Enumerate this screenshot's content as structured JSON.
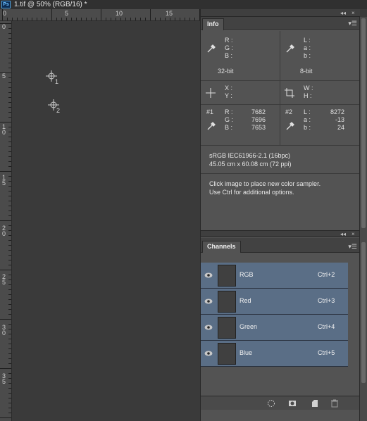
{
  "app_badge": "Ps",
  "document_title": "1.tif @ 50% (RGB/16) *",
  "rulers": {
    "top_numbers": [
      "0",
      "5",
      "10",
      "15"
    ],
    "left_numbers": [
      "0",
      "5",
      "10",
      "15",
      "20",
      "25",
      "30",
      "35"
    ]
  },
  "samplers": [
    {
      "label": "1"
    },
    {
      "label": "2"
    }
  ],
  "dock_controls": {
    "collapse": "◂◂",
    "close": "×"
  },
  "info_panel": {
    "tab_label": "Info",
    "menu_icon": "panel-menu-icon",
    "rgb_labels": {
      "r": "R :",
      "g": "G :",
      "b": "B :"
    },
    "lab_labels": {
      "l": "L :",
      "a": "a :",
      "b": "b :"
    },
    "left_bit_depth": "32-bit",
    "right_bit_depth": "8-bit",
    "xy_labels": {
      "x": "X :",
      "y": "Y :"
    },
    "wh_labels": {
      "w": "W :",
      "h": "H :"
    },
    "sampler1": {
      "id": "#1",
      "r_label": "R :",
      "g_label": "G :",
      "b_label": "B :",
      "r": "7682",
      "g": "7696",
      "b": "7653"
    },
    "sampler2": {
      "id": "#2",
      "l_label": "L :",
      "a_label": "a :",
      "b_label": "b :",
      "l": "8272",
      "a": "-13",
      "b": "24"
    },
    "profile": "sRGB IEC61966-2.1 (16bpc)",
    "doc_size": "45.05 cm x 60.08 cm (72 ppi)",
    "hint_line1": "Click image to place new color sampler.",
    "hint_line2": "Use Ctrl for additional options."
  },
  "channels_panel": {
    "tab_label": "Channels",
    "channels": [
      {
        "name": "RGB",
        "shortcut": "Ctrl+2"
      },
      {
        "name": "Red",
        "shortcut": "Ctrl+3"
      },
      {
        "name": "Green",
        "shortcut": "Ctrl+4"
      },
      {
        "name": "Blue",
        "shortcut": "Ctrl+5"
      }
    ],
    "footer_icons": [
      "load-selection-icon",
      "save-selection-icon",
      "new-channel-icon",
      "trash-icon"
    ]
  },
  "colors": {
    "channel_highlight": "#5a6e86",
    "panel_bg": "#535353",
    "canvas_bg": "#3a3a3a"
  }
}
